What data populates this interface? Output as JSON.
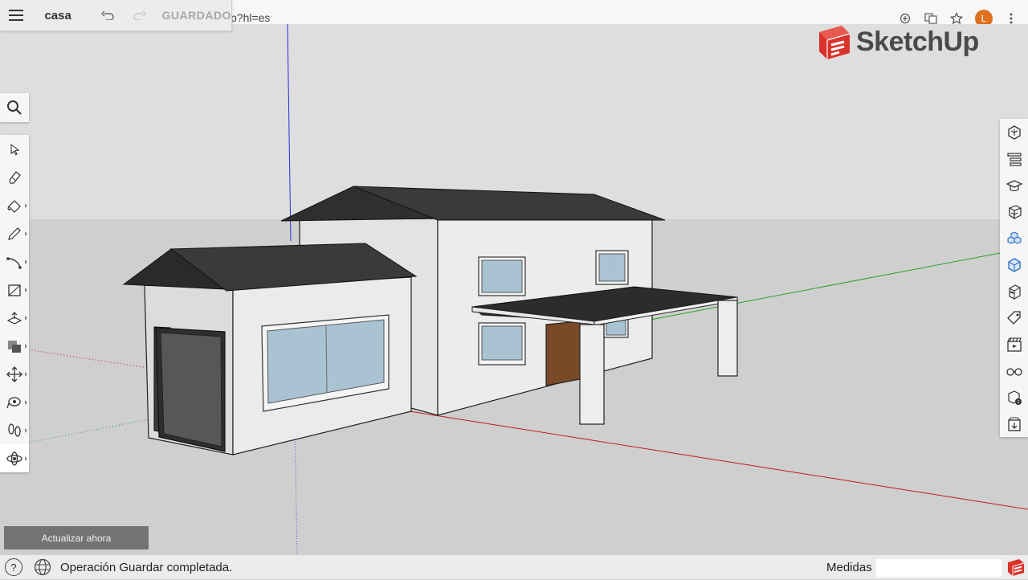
{
  "browser": {
    "url_fragment": "p?hl=es",
    "profile_initial": "L"
  },
  "appbar": {
    "document_title": "casa",
    "save_status": "GUARDADO"
  },
  "logo": {
    "text": "SketchUp"
  },
  "left_toolbar": {
    "tools": [
      {
        "name": "select",
        "icon": "arrow-icon"
      },
      {
        "name": "eraser",
        "icon": "eraser-icon"
      },
      {
        "name": "paint",
        "icon": "paint-bucket-icon"
      },
      {
        "name": "pencil",
        "icon": "pencil-icon"
      },
      {
        "name": "arc",
        "icon": "arc-icon"
      },
      {
        "name": "rectangle",
        "icon": "rectangle-icon"
      },
      {
        "name": "push-pull",
        "icon": "push-pull-icon"
      },
      {
        "name": "offset",
        "icon": "offset-icon"
      },
      {
        "name": "move",
        "icon": "move-icon"
      },
      {
        "name": "tape",
        "icon": "tape-measure-icon"
      },
      {
        "name": "walk",
        "icon": "footprints-icon"
      },
      {
        "name": "orbit",
        "icon": "orbit-icon"
      }
    ]
  },
  "right_toolbar": {
    "panels": [
      "entity-info-icon",
      "outliner-icon",
      "instructor-icon",
      "components-icon",
      "3d-warehouse-icon",
      "materials-icon",
      "styles-icon",
      "tags-icon",
      "scenes-icon",
      "display-icon",
      "model-info-icon",
      "extension-icon"
    ]
  },
  "update_button": {
    "label": "Actualizar ahora"
  },
  "statusbar": {
    "message": "Operación Guardar completada.",
    "measure_label": "Medidas",
    "measure_value": ""
  },
  "colors": {
    "sky": "#dedede",
    "ground": "#cfcfcf",
    "roof": "#3a3a3a",
    "wall": "#e6e6e6",
    "glass": "#a9c3d3",
    "door": "#7a4a28",
    "axis_red": "#c41a1a",
    "axis_green": "#2aa12a",
    "axis_blue": "#2a2adb"
  }
}
